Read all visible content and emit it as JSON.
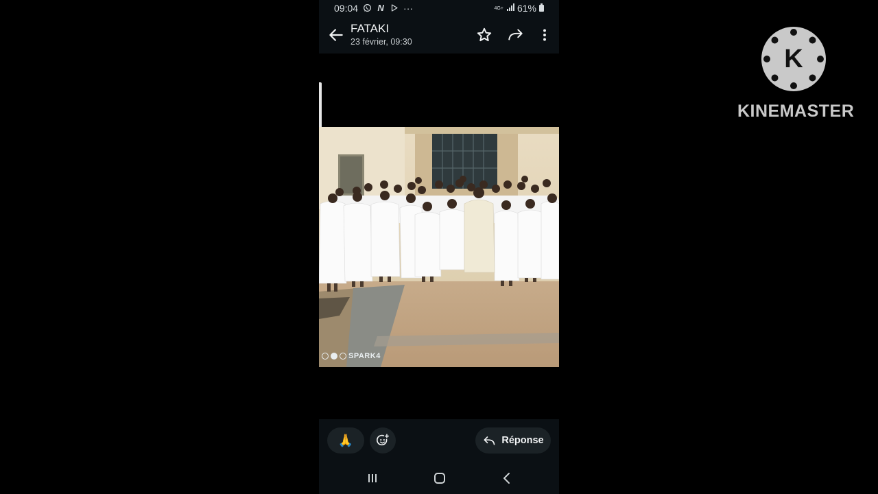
{
  "status_bar": {
    "time": "09:04",
    "network": "4G+",
    "battery": "61%",
    "more": "···"
  },
  "header": {
    "title": "FATAKI",
    "subtitle": "23 février, 09:30"
  },
  "photo": {
    "watermark": "SPARK4"
  },
  "bottom_bar": {
    "reaction_emoji": "🙏",
    "reply_label": "Réponse"
  },
  "overlay": {
    "brand": "KINEMASTER",
    "logo_letter": "K"
  },
  "colors": {
    "bar_background": "#0b1014",
    "pill_background": "#1b2226",
    "text_primary": "#f1f3f4"
  },
  "icons": {
    "back": "arrow-back-icon",
    "star": "star-outline-icon",
    "forward": "forward-icon",
    "more": "more-vert-icon",
    "emoji_add": "add-reaction-icon",
    "reply": "reply-icon",
    "recents": "recents-icon",
    "home": "home-icon",
    "nav_back": "nav-back-icon"
  }
}
